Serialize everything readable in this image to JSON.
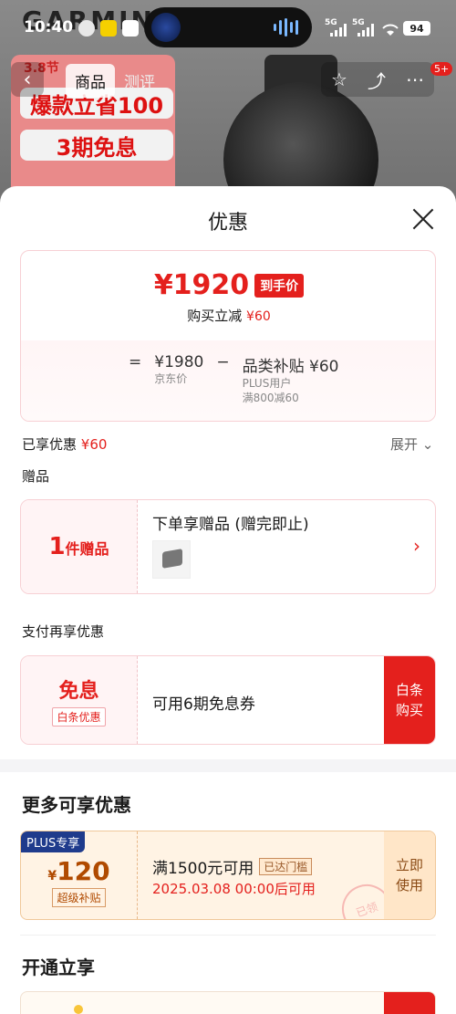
{
  "status_bar": {
    "time": "10:40",
    "signal1": "5G",
    "signal2": "5G",
    "battery": "94"
  },
  "background": {
    "brand": "GARMIN",
    "promo_top": "3.8节",
    "promo_line1": "爆款立省100",
    "promo_line2": "3期免息"
  },
  "nav": {
    "tabs": [
      {
        "label": "商品"
      },
      {
        "label": "测评"
      }
    ],
    "badge": "5+"
  },
  "sheet": {
    "title": "优惠",
    "price": {
      "final": "¥1920",
      "final_tag": "到手价",
      "reduce_label": "购买立减",
      "reduce_value": "¥60",
      "equals": "=",
      "jd_price": "¥1980",
      "jd_price_label": "京东价",
      "minus": "−",
      "subsidy_label": "品类补贴",
      "subsidy_value": "¥60",
      "subsidy_note1": "PLUS用户",
      "subsidy_note2": "满800减60"
    },
    "enjoyed_label": "已享优惠",
    "enjoyed_value": "¥60",
    "expand_label": "展开",
    "gift_heading": "赠品",
    "gift": {
      "count": "1",
      "unit": "件赠品",
      "text": "下单享赠品 (赠完即止)"
    },
    "pay_heading": "支付再享优惠",
    "pay": {
      "title": "免息",
      "tag": "白条优惠",
      "text": "可用6期免息券",
      "button_line1": "白条",
      "button_line2": "购买"
    },
    "more_heading": "更多可享优惠",
    "coupon": {
      "plus_tag": "PLUS专享",
      "currency": "¥",
      "amount": "120",
      "sub_label": "超级补贴",
      "title": "满1500元可用",
      "reach_tag": "已达门槛",
      "date": "2025.03.08 00:00后可用",
      "button_line1": "立即",
      "button_line2": "使用",
      "stamp": "已领"
    },
    "open_heading": "开通立享"
  },
  "colors": {
    "accent_red": "#e4201d",
    "plus_blue": "#1f3b8c",
    "coupon_bg": "#fff3e4"
  }
}
